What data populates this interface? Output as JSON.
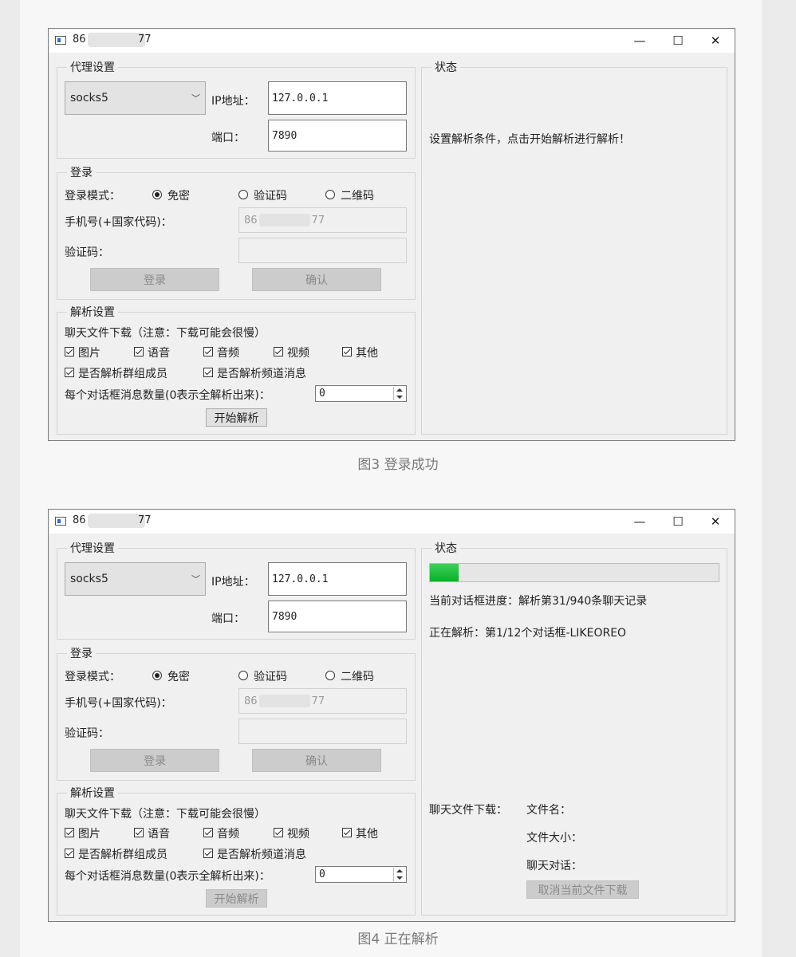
{
  "windows": [
    {
      "title_start": "86",
      "title_end": "77",
      "proxy": {
        "legend": "代理设置",
        "type_value": "socks5",
        "ip_label": "IP地址：",
        "ip_value": "127.0.0.1",
        "port_label": "端口：",
        "port_value": "7890"
      },
      "login": {
        "legend": "登录",
        "mode_label": "登录模式：",
        "modes": [
          "免密",
          "验证码",
          "二维码"
        ],
        "selected_mode": "免密",
        "phone_label": "手机号(+国家代码)：",
        "phone_start": "86",
        "phone_end": "77",
        "code_label": "验证码：",
        "login_button": "登录",
        "confirm_button": "确认"
      },
      "parse": {
        "legend": "解析设置",
        "download_note": "聊天文件下载（注意：下载可能会很慢）",
        "file_types": [
          "图片",
          "语音",
          "音频",
          "视频",
          "其他"
        ],
        "group_members": "是否解析群组成员",
        "channel_messages": "是否解析频道消息",
        "count_label": "每个对话框消息数量(0表示全解析出来)：",
        "count_value": "0",
        "start_button": "开始解析"
      },
      "status": {
        "legend": "状态",
        "message": "设置解析条件，点击开始解析进行解析！"
      }
    },
    {
      "title_start": "86",
      "title_end": "77",
      "proxy": {
        "legend": "代理设置",
        "type_value": "socks5",
        "ip_label": "IP地址：",
        "ip_value": "127.0.0.1",
        "port_label": "端口：",
        "port_value": "7890"
      },
      "login": {
        "legend": "登录",
        "mode_label": "登录模式：",
        "modes": [
          "免密",
          "验证码",
          "二维码"
        ],
        "selected_mode": "免密",
        "phone_label": "手机号(+国家代码)：",
        "phone_start": "86",
        "phone_end": "77",
        "code_label": "验证码：",
        "login_button": "登录",
        "confirm_button": "确认"
      },
      "parse": {
        "legend": "解析设置",
        "download_note": "聊天文件下载（注意：下载可能会很慢）",
        "file_types": [
          "图片",
          "语音",
          "音频",
          "视频",
          "其他"
        ],
        "group_members": "是否解析群组成员",
        "channel_messages": "是否解析频道消息",
        "count_label": "每个对话框消息数量(0表示全解析出来)：",
        "count_value": "0",
        "start_button": "开始解析"
      },
      "status": {
        "legend": "状态",
        "progress_fraction": 0.1,
        "dialog_progress": "当前对话框进度：解析第31/940条聊天记录",
        "current_dialog": "正在解析：第1/12个对话框-LIKEOREO",
        "download_label": "聊天文件下载：",
        "file_name_label": "文件名：",
        "file_size_label": "文件大小：",
        "chat_label": "聊天对话：",
        "cancel_button": "取消当前文件下载"
      }
    }
  ],
  "captions": [
    "图3 登录成功",
    "图4 正在解析"
  ]
}
